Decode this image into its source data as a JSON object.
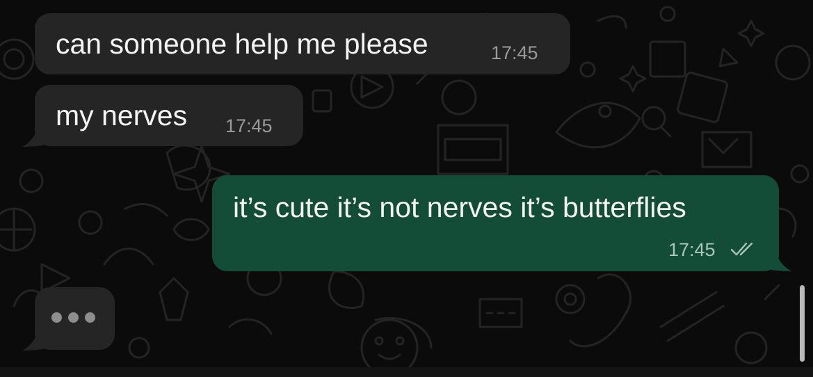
{
  "messages": [
    {
      "direction": "incoming",
      "text": "can someone help me please",
      "time": "17:45"
    },
    {
      "direction": "incoming",
      "text": "my nerves",
      "time": "17:45"
    },
    {
      "direction": "outgoing",
      "text": "it’s cute it’s not nerves it’s butterflies",
      "time": "17:45",
      "status": "read",
      "status_icon": "double-check-icon"
    }
  ],
  "typing_indicator": {
    "visible": true,
    "dot_count": 3,
    "icon": "typing-dots-icon"
  },
  "colors": {
    "background": "#0b0b0b",
    "incoming_bubble": "#252525",
    "outgoing_bubble": "#144d37",
    "message_text": "#f4f4f4",
    "timestamp": "#9a9a9a",
    "wallpaper_doodle": "#242424"
  }
}
